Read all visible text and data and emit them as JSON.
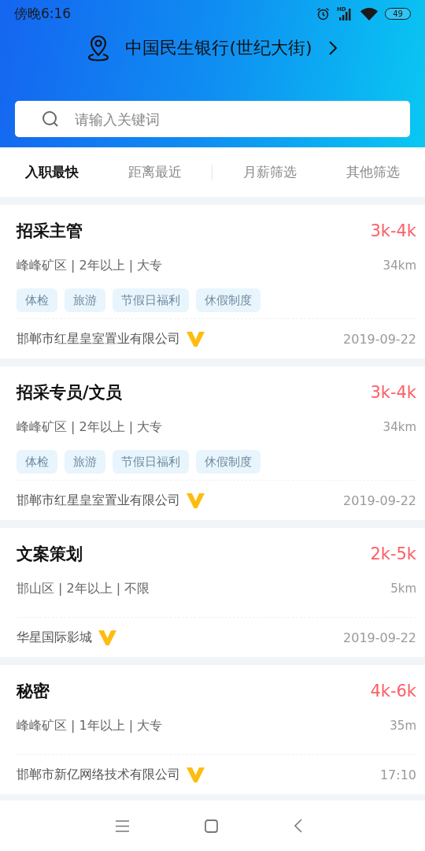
{
  "status_bar": {
    "time": "傍晚6:16",
    "network": "HD",
    "battery": "49"
  },
  "location": {
    "name": "中国民生银行(世纪大街)"
  },
  "search": {
    "placeholder": "请输入关键词"
  },
  "tabs": [
    {
      "label": "入职最快",
      "selected": true
    },
    {
      "label": "距离最近",
      "selected": false
    },
    {
      "label": "月薪筛选",
      "selected": false
    },
    {
      "label": "其他筛选",
      "selected": false
    }
  ],
  "jobs": [
    {
      "title": "招采主管",
      "salary": "3k-4k",
      "meta": "峰峰矿区 | 2年以上 | 大专",
      "distance": "34km",
      "tags": [
        "体检",
        "旅游",
        "节假日福利",
        "休假制度"
      ],
      "company": "邯郸市红星皇室置业有限公司",
      "verified": true,
      "date": "2019-09-22"
    },
    {
      "title": "招采专员/文员",
      "salary": "3k-4k",
      "meta": "峰峰矿区 | 2年以上 | 大专",
      "distance": "34km",
      "tags": [
        "体检",
        "旅游",
        "节假日福利",
        "休假制度"
      ],
      "company": "邯郸市红星皇室置业有限公司",
      "verified": true,
      "date": "2019-09-22"
    },
    {
      "title": "文案策划",
      "salary": "2k-5k",
      "meta": "邯山区 | 2年以上 | 不限",
      "distance": "5km",
      "company": "华星国际影城",
      "verified": true,
      "date": "2019-09-22"
    },
    {
      "title": "秘密",
      "salary": "4k-6k",
      "meta": "峰峰矿区 | 1年以上 | 大专",
      "distance": "35m",
      "company": "邯郸市新亿网络技术有限公司",
      "verified": true,
      "date": "17:10"
    }
  ]
}
